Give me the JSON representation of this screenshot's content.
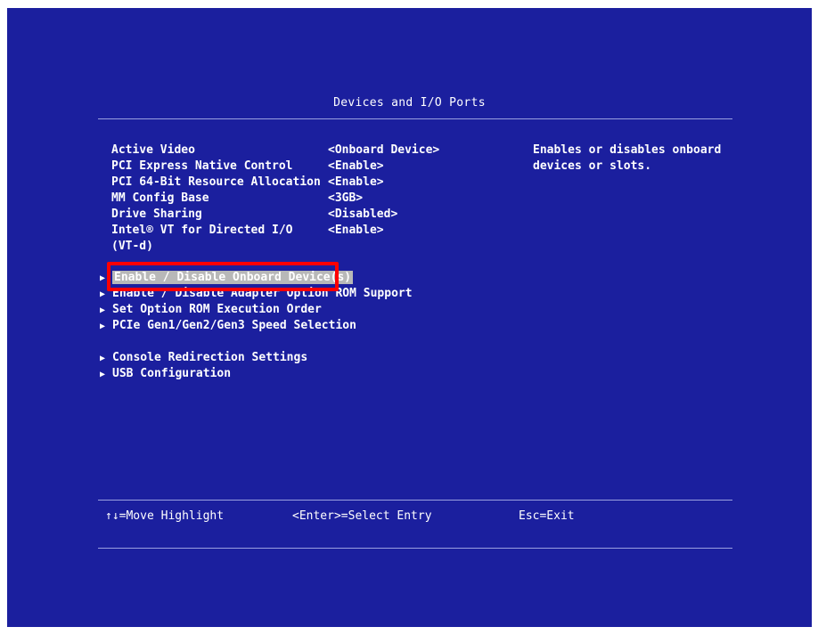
{
  "title": "Devices and I/O Ports",
  "settings": [
    {
      "label": "Active Video",
      "value": "<Onboard Device>"
    },
    {
      "label": "PCI Express Native Control",
      "value": "<Enable>"
    },
    {
      "label": "PCI 64-Bit Resource Allocation",
      "value": "<Enable>"
    },
    {
      "label": "MM Config Base",
      "value": "<3GB>"
    },
    {
      "label": "Drive Sharing",
      "value": "<Disabled>"
    },
    {
      "label": "Intel® VT for Directed I/O",
      "value": "<Enable>"
    },
    {
      "label": "(VT-d)",
      "value": ""
    }
  ],
  "help_text": "Enables or disables onboard devices or slots.",
  "menu_items": [
    {
      "label": "Enable / Disable Onboard Device(s)"
    },
    {
      "label": "Enable / Disable Adapter Option ROM Support"
    },
    {
      "label": "Set Option ROM Execution Order"
    },
    {
      "label": "PCIe Gen1/Gen2/Gen3 Speed Selection"
    },
    {
      "label": "Console Redirection Settings"
    },
    {
      "label": "USB Configuration"
    }
  ],
  "footer": {
    "move": "↑↓=Move Highlight",
    "select": "<Enter>=Select Entry",
    "exit": "Esc=Exit"
  },
  "colors": {
    "background": "#1b1f9e",
    "highlight": "#b8b8b8",
    "annotation": "#ff0000"
  }
}
